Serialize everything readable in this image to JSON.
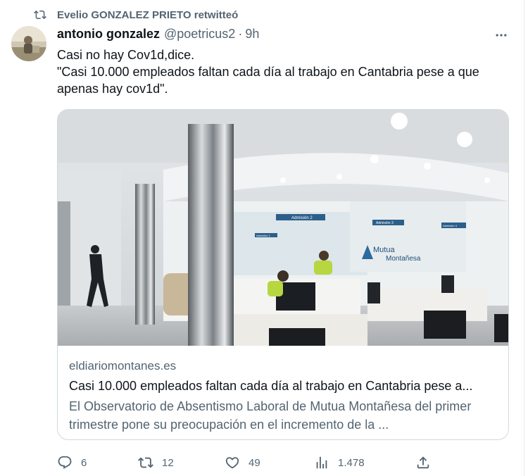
{
  "retweet": {
    "label": "Evelio GONZALEZ PRIETO retwitteó",
    "icon": "retweet-icon"
  },
  "author": {
    "name": "antonio gonzalez",
    "handle": "@poetricus2",
    "separator": "·",
    "time": "9h"
  },
  "tweet": {
    "lines": [
      "Casi no hay Cov1d,dice.",
      "\"Casi 10.000 empleados faltan cada día al trabajo en Cantabria pese a que apenas hay cov1d\"."
    ]
  },
  "card": {
    "domain": "eldiariomontanes.es",
    "title": "Casi 10.000 empleados faltan cada día al trabajo en Cantabria pese a...",
    "description": "El Observatorio de Absentismo Laboral de Mutua Montañesa del primer trimestre pone su preocupación en el incremento de la ...",
    "image_signs": {
      "brand_line1": "Mutua",
      "brand_line2": "Montañesa",
      "desk_sign_1": "Admisión 2",
      "desk_sign_2": "Admisión 3",
      "desk_sign_3": "Admisión 1",
      "desk_sign_4": "Admisión 4"
    }
  },
  "actions": {
    "replies": "6",
    "retweets": "12",
    "likes": "49",
    "views": "1.478"
  },
  "colors": {
    "text": "#0f1419",
    "secondary": "#536471",
    "border": "#cfd9de"
  }
}
